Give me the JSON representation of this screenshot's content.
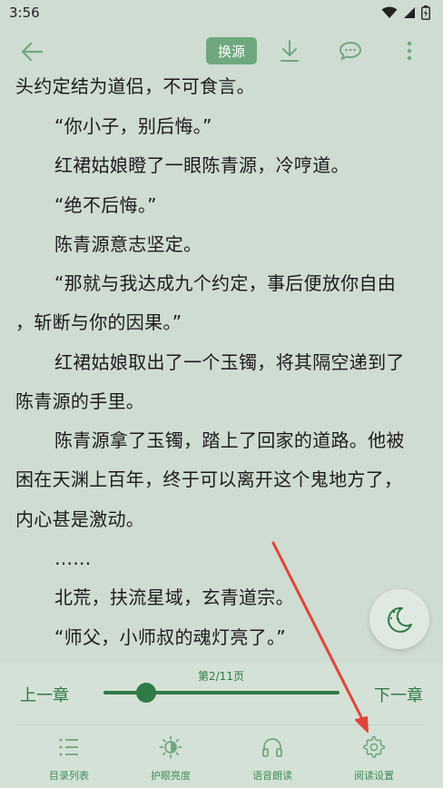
{
  "status_bar": {
    "time": "3:56"
  },
  "toolbar": {
    "source_label": "换源"
  },
  "reader": {
    "lines": [
      {
        "text": "头约定结为道侣，不可食言。",
        "indent": false
      },
      {
        "text": "“你小子，别后悔。”",
        "indent": true
      },
      {
        "text": "红裙姑娘瞪了一眼陈青源，冷哼道。",
        "indent": true
      },
      {
        "text": "“绝不后悔。”",
        "indent": true
      },
      {
        "text": "陈青源意志坚定。",
        "indent": true
      },
      {
        "text": "“那就与我达成九个约定，事后便放你自由",
        "indent": true
      },
      {
        "text": "，斩断与你的因果。”",
        "indent": false
      },
      {
        "text": "红裙姑娘取出了一个玉镯，将其隔空递到了",
        "indent": true
      },
      {
        "text": "陈青源的手里。",
        "indent": false
      },
      {
        "text": "陈青源拿了玉镯，踏上了回家的道路。他被",
        "indent": true
      },
      {
        "text": "困在天渊上百年，终于可以离开这个鬼地方了，",
        "indent": false
      },
      {
        "text": "内心甚是激动。",
        "indent": false
      },
      {
        "text": "……",
        "indent": true
      },
      {
        "text": "北荒，扶流星域，玄青道宗。",
        "indent": true
      },
      {
        "text": "“师父，小师叔的魂灯亮了。”",
        "indent": true
      }
    ]
  },
  "bottom_panel": {
    "prev_chapter": "上一章",
    "next_chapter": "下一章",
    "page_indicator": "第2/11页",
    "progress": 0.18,
    "nav": [
      {
        "label": "目录列表",
        "icon": "list-icon"
      },
      {
        "label": "护眼亮度",
        "icon": "brightness-icon"
      },
      {
        "label": "语音朗读",
        "icon": "headphones-icon"
      },
      {
        "label": "阅读设置",
        "icon": "settings-gear-icon"
      }
    ]
  },
  "colors": {
    "background": "#cfdcd2",
    "accent": "#2f7a45",
    "source_button": "#6fa87f",
    "annotation": "#e0453a"
  }
}
